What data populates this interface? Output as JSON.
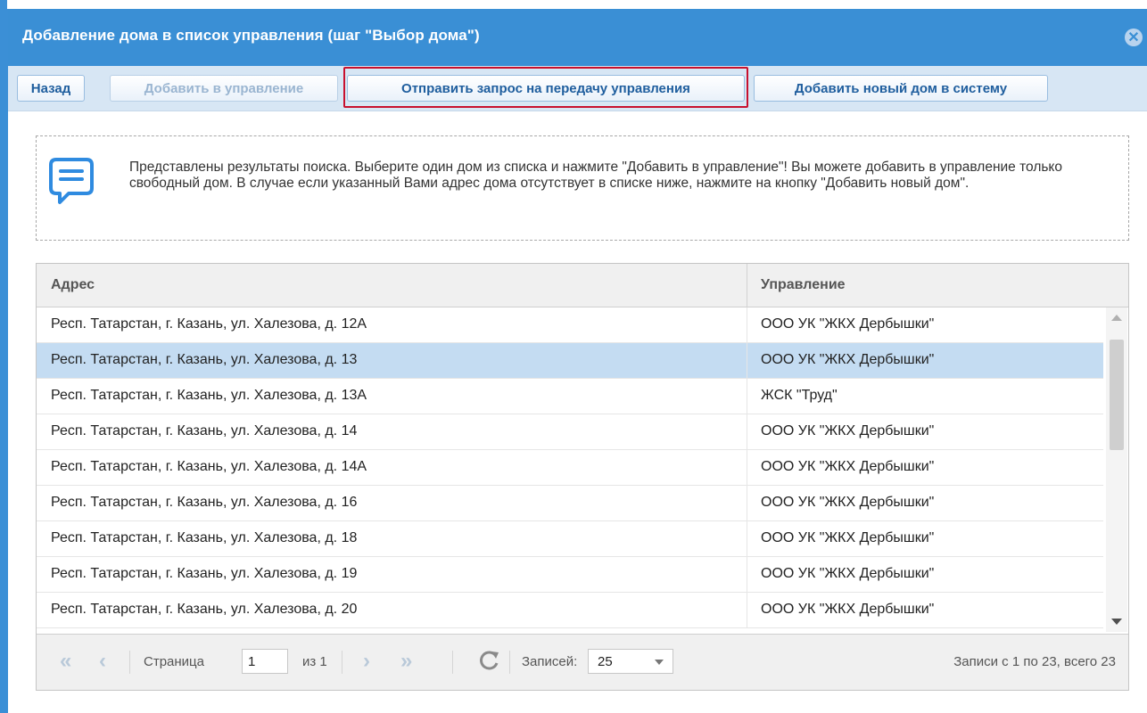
{
  "window": {
    "title": "Добавление дома в список управления (шаг \"Выбор дома\")",
    "close_symbol": "✕"
  },
  "toolbar": {
    "back_label": "Назад",
    "add_label": "Добавить в управление",
    "send_request_label": "Отправить запрос на передачу управления",
    "add_new_house_label": "Добавить новый дом в систему"
  },
  "info": {
    "icon": "chat-bubble-icon",
    "text": "Представлены результаты поиска. Выберите один дом из списка и нажмите \"Добавить в управление\"! Вы можете добавить в управление только свободный дом. В случае если указанный Вами адрес дома отсутствует в списке ниже, нажмите на кнопку \"Добавить новый дом\"."
  },
  "grid": {
    "columns": {
      "address": "Адрес",
      "management": "Управление"
    },
    "rows": [
      {
        "address": "Респ. Татарстан, г. Казань, ул. Халезова, д. 12А",
        "management": "ООО УК \"ЖКХ Дербышки\""
      },
      {
        "address": "Респ. Татарстан, г. Казань, ул. Халезова, д. 13",
        "management": "ООО УК \"ЖКХ Дербышки\""
      },
      {
        "address": "Респ. Татарстан, г. Казань, ул. Халезова, д. 13А",
        "management": "ЖСК \"Труд\""
      },
      {
        "address": "Респ. Татарстан, г. Казань, ул. Халезова, д. 14",
        "management": "ООО УК \"ЖКХ Дербышки\""
      },
      {
        "address": "Респ. Татарстан, г. Казань, ул. Халезова, д. 14А",
        "management": "ООО УК \"ЖКХ Дербышки\""
      },
      {
        "address": "Респ. Татарстан, г. Казань, ул. Халезова, д. 16",
        "management": "ООО УК \"ЖКХ Дербышки\""
      },
      {
        "address": "Респ. Татарстан, г. Казань, ул. Халезова, д. 18",
        "management": "ООО УК \"ЖКХ Дербышки\""
      },
      {
        "address": "Респ. Татарстан, г. Казань, ул. Халезова, д. 19",
        "management": "ООО УК \"ЖКХ Дербышки\""
      },
      {
        "address": "Респ. Татарстан, г. Казань, ул. Халезова, д. 20",
        "management": "ООО УК \"ЖКХ Дербышки\""
      }
    ],
    "selected_row_index": 1
  },
  "pager": {
    "page_label": "Страница",
    "page_value": "1",
    "of_label": "из 1",
    "records_label": "Записей:",
    "records_value": "25",
    "summary": "Записи с 1 по 23, всего 23"
  },
  "colors": {
    "titlebar": "#3a8fd5",
    "toolbar": "#d7e6f4",
    "selected_row": "#c4dcf2",
    "highlight_border": "#c8102e"
  }
}
